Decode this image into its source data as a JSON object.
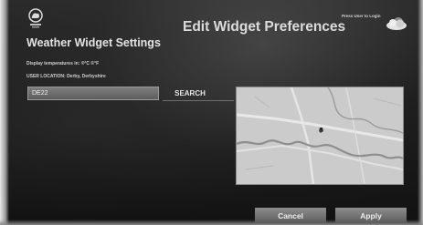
{
  "header": {
    "page_title": "Edit Widget Preferences",
    "login_hint": "Press User to Login",
    "logo_icon": "weather-logo-icon",
    "weather_icon": "cloud-icon"
  },
  "settings": {
    "title": "Weather Widget Settings",
    "temperature_line": "Display temperatures in: ®°C ®°F",
    "location_line": "USER LOCATION: Derby, Derbyshire"
  },
  "search": {
    "value": "DE22",
    "button_label": "SEARCH"
  },
  "map": {
    "marker_icon": "location-pin-icon"
  },
  "footer": {
    "cancel_label": "Cancel",
    "apply_label": "Apply"
  }
}
